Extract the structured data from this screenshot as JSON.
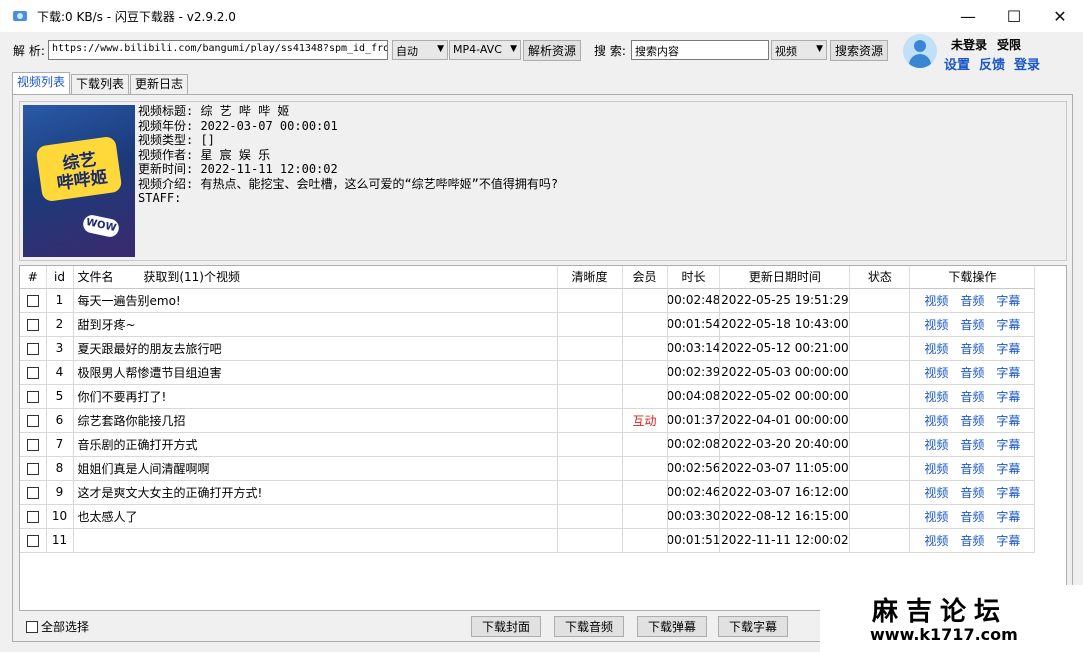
{
  "window": {
    "title": "下载:0 KB/s - 闪豆下载器 - v2.9.2.0",
    "minimize": "—",
    "maximize": "☐",
    "close": "✕"
  },
  "toolbar": {
    "parse_label": "解 析:",
    "url_value": "https://www.bilibili.com/bangumi/play/ss41348?spm_id_from",
    "quality_select": "自动",
    "format_select": "MP4-AVC",
    "parse_button": "解析资源",
    "search_label": "搜 索:",
    "search_placeholder": "搜索内容",
    "search_type": "视频",
    "search_button": "搜索资源"
  },
  "user": {
    "status": "未登录",
    "limit": "受限",
    "settings": "设置",
    "feedback": "反馈",
    "login": "登录"
  },
  "tabs": [
    "视频列表",
    "下载列表",
    "更新日志"
  ],
  "info": {
    "cover_text": "综艺\n哔哔姬",
    "cover_badge": "WOW",
    "lines": [
      "视频标题: 综 艺 哔 哔 姬",
      "视频年份: 2022-03-07 00:00:01",
      "视频类型: []",
      "视频作者: 星 宸 娱 乐",
      "更新时间: 2022-11-11 12:00:02",
      "视频介绍: 有热点、能挖宝、会吐槽，这么可爱的“综艺哔哔姬”不值得拥有吗?",
      "STAFF:"
    ]
  },
  "table": {
    "headers": {
      "check": "#",
      "id": "id",
      "filename": "文件名",
      "fetched": "获取到(11)个视频",
      "quality": "清晰度",
      "vip": "会员",
      "duration": "时长",
      "updated": "更新日期时间",
      "status": "状态",
      "ops": "下载操作"
    },
    "op_labels": {
      "video": "视频",
      "audio": "音频",
      "subtitle": "字幕"
    },
    "rows": [
      {
        "id": "1",
        "name": "每天一遍告别emo!",
        "vip": "",
        "duration": "00:02:48",
        "updated": "2022-05-25 19:51:29"
      },
      {
        "id": "2",
        "name": "甜到牙疼~",
        "vip": "",
        "duration": "00:01:54",
        "updated": "2022-05-18 10:43:00"
      },
      {
        "id": "3",
        "name": "夏天跟最好的朋友去旅行吧",
        "vip": "",
        "duration": "00:03:14",
        "updated": "2022-05-12 00:21:00"
      },
      {
        "id": "4",
        "name": "极限男人帮惨遭节目组迫害",
        "vip": "",
        "duration": "00:02:39",
        "updated": "2022-05-03 00:00:00"
      },
      {
        "id": "5",
        "name": "你们不要再打了!",
        "vip": "",
        "duration": "00:04:08",
        "updated": "2022-05-02 00:00:00"
      },
      {
        "id": "6",
        "name": "综艺套路你能接几招",
        "vip": "互动",
        "duration": "00:01:37",
        "updated": "2022-04-01 00:00:00"
      },
      {
        "id": "7",
        "name": "音乐剧的正确打开方式",
        "vip": "",
        "duration": "00:02:08",
        "updated": "2022-03-20 20:40:00"
      },
      {
        "id": "8",
        "name": "姐姐们真是人间清醒啊啊",
        "vip": "",
        "duration": "00:02:56",
        "updated": "2022-03-07 11:05:00"
      },
      {
        "id": "9",
        "name": "这才是爽文大女主的正确打开方式!",
        "vip": "",
        "duration": "00:02:46",
        "updated": "2022-03-07 16:12:00"
      },
      {
        "id": "10",
        "name": "也太感人了",
        "vip": "",
        "duration": "00:03:30",
        "updated": "2022-08-12 16:15:00"
      },
      {
        "id": "11",
        "name": "",
        "vip": "",
        "duration": "00:01:51",
        "updated": "2022-11-11 12:00:02"
      }
    ]
  },
  "footer": {
    "select_all": "全部选择",
    "download_cover": "下载封面",
    "download_audio": "下载音频",
    "download_danmaku": "下载弹幕",
    "download_subtitle": "下载字幕"
  },
  "watermark": {
    "line1": "麻吉论坛",
    "line2": "www.k1717.com"
  }
}
